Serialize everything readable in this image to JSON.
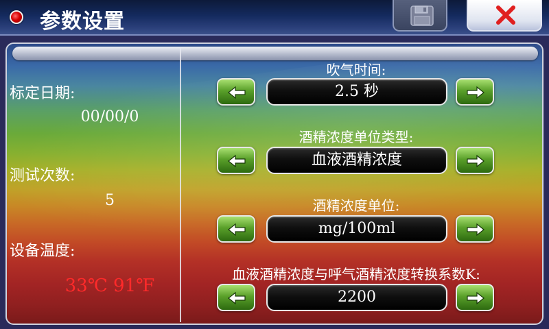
{
  "window": {
    "title": "参数设置"
  },
  "toolbar": {
    "save_icon": "floppy-disk-icon",
    "close_icon": "close-x-icon",
    "close_color": "#e02020"
  },
  "left_panel": {
    "calibration_date_label": "标定日期:",
    "calibration_date_value": "00/00/0",
    "test_count_label": "测试次数:",
    "test_count_value": "5",
    "device_temp_label": "设备温度:",
    "device_temp_value": "33℃ 91℉",
    "device_temp_color": "#ff2a2a"
  },
  "params": [
    {
      "label": "吹气时间:",
      "value": "2.5 秒"
    },
    {
      "label": "酒精浓度单位类型:",
      "value": "血液酒精浓度"
    },
    {
      "label": "酒精浓度单位:",
      "value": "mg/100ml"
    },
    {
      "label": "血液酒精浓度与呼气酒精浓度转换系数K:",
      "value": "2200"
    }
  ],
  "arrows": {
    "left_icon": "arrow-left-icon",
    "right_icon": "arrow-right-icon",
    "button_color": "#5aa02a"
  }
}
